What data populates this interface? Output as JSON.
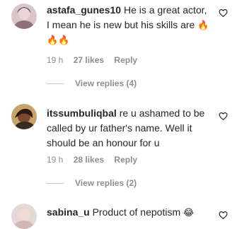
{
  "comments": [
    {
      "username": "astafa_gunes10",
      "text": "He is a great actor, I mean he is new but his skills are",
      "emoji": "🔥",
      "emoji_trail": "🔥🔥",
      "time": "19 h",
      "likes": "27 likes",
      "reply": "Reply",
      "view_replies": "View replies (4)"
    },
    {
      "username": "itssumbuliqbal",
      "text": "re u ashamed to be called by ur father's name. Well it should be an honour for u",
      "time": "19 h",
      "likes": "28 likes",
      "reply": "Reply",
      "view_replies": "View replies (2)"
    },
    {
      "username": "sabina_u",
      "text": "Product of nepotism",
      "emoji": "😂"
    }
  ],
  "icons": {
    "like": "heart-outline-icon"
  }
}
